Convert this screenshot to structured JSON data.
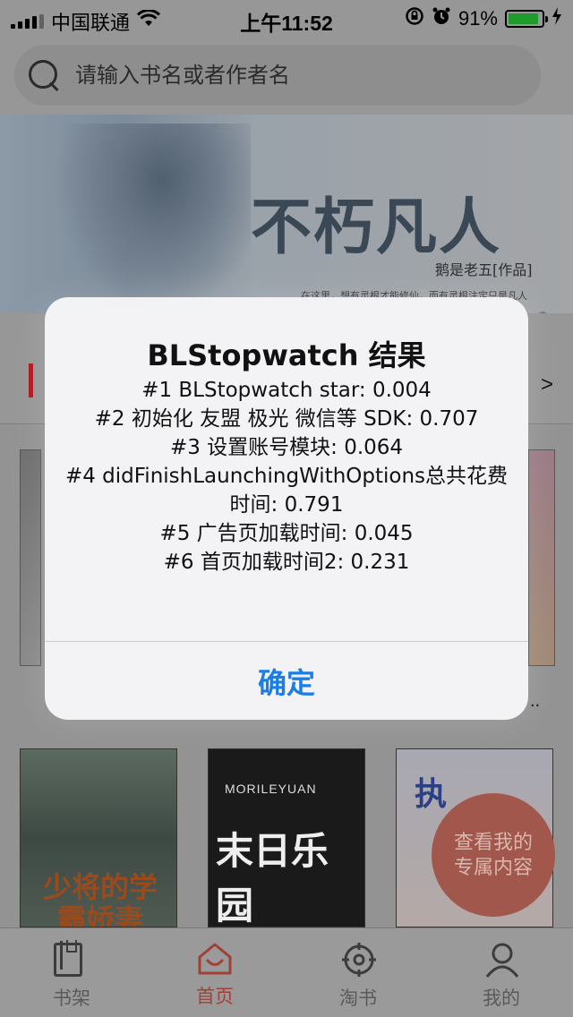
{
  "status_bar": {
    "carrier": "中国联通",
    "time": "上午11:52",
    "battery_percent": "91%",
    "battery_level": 0.91,
    "battery_color": "#1f9a2c"
  },
  "search": {
    "placeholder": "请输入书名或者作者名"
  },
  "banner": {
    "title": "不朽凡人",
    "author": "鹅是老五[作品]",
    "slogan": "在这里，想有灵根才能修仙，而有灵根注定只是凡人"
  },
  "section": {
    "more": ">"
  },
  "books": {
    "ellipsis": "..",
    "covers": [
      {
        "title": "少将的学霸娇妻"
      },
      {
        "subtitle": "MORILEYUAN",
        "title": "末日乐园"
      },
      {
        "title": "执"
      }
    ]
  },
  "floating_button": {
    "label": "查看我的专属内容"
  },
  "tabs": [
    {
      "label": "书架",
      "icon": "bookshelf-icon",
      "active": false
    },
    {
      "label": "首页",
      "icon": "home-icon",
      "active": true
    },
    {
      "label": "淘书",
      "icon": "target-icon",
      "active": false
    },
    {
      "label": "我的",
      "icon": "person-icon",
      "active": false
    }
  ],
  "alert": {
    "title": "BLStopwatch 结果",
    "lines": [
      "#1 BLStopwatch star: 0.004",
      "#2 初始化 友盟 极光 微信等 SDK: 0.707",
      "#3 设置账号模块: 0.064",
      "#4 didFinishLaunchingWithOptions总共花费时间: 0.791",
      "#5 广告页加载时间: 0.045",
      "#6 首页加载时间2: 0.231"
    ],
    "confirm": "确定"
  },
  "colors": {
    "accent_red": "#b0171d",
    "alert_button_blue": "#1a7ee6",
    "tab_active": "#a04037"
  }
}
